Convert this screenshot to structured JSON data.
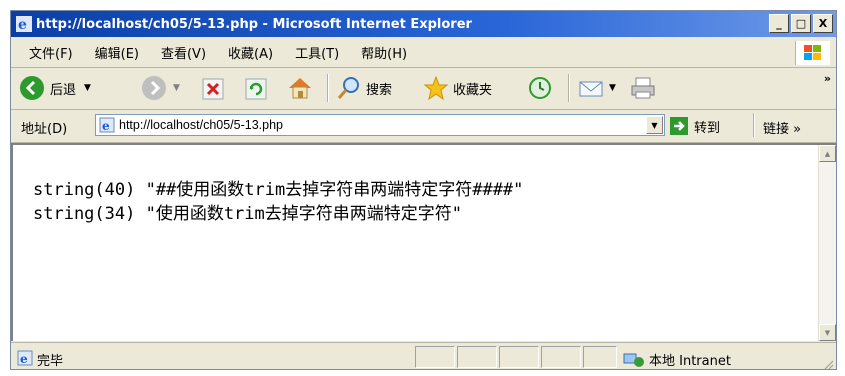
{
  "window": {
    "title": "http://localhost/ch05/5-13.php - Microsoft Internet Explorer",
    "buttons": {
      "minimize": "_",
      "maximize": "□",
      "close": "X"
    }
  },
  "menu": {
    "items": [
      "文件(F)",
      "编辑(E)",
      "查看(V)",
      "收藏(A)",
      "工具(T)",
      "帮助(H)"
    ]
  },
  "toolbar": {
    "back_label": "后退",
    "search_label": "搜索",
    "favorites_label": "收藏夹",
    "more": "»"
  },
  "address": {
    "label": "地址(D)",
    "url": "http://localhost/ch05/5-13.php",
    "go_label": "转到",
    "links_label": "链接 »"
  },
  "content": {
    "lines": [
      "string(40) \"##使用函数trim去掉字符串两端特定字符####\"",
      "string(34) \"使用函数trim去掉字符串两端特定字符\""
    ]
  },
  "status": {
    "text": "完毕",
    "zone": "本地 Intranet"
  }
}
